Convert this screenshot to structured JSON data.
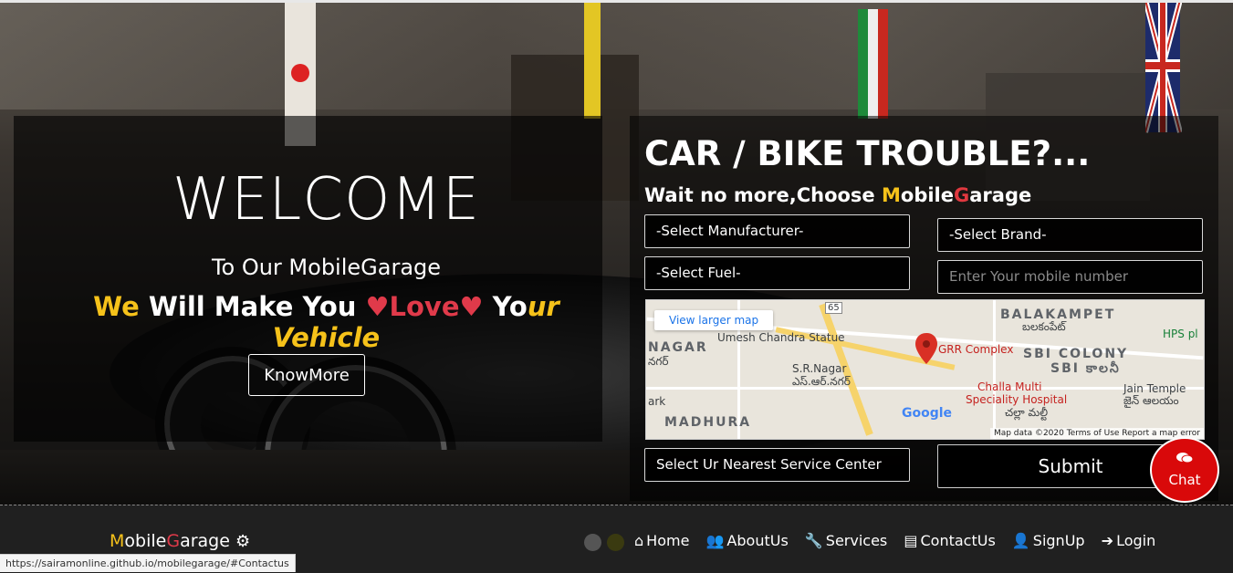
{
  "welcome": {
    "title": "WELCOME",
    "subtitle": "To Our MobileGarage",
    "tag_we": "We",
    "tag_mid": " Will Make You ",
    "tag_heart1": "♥",
    "tag_love": "Love",
    "tag_heart2": "♥",
    "tag_yo": " Yo",
    "tag_ur": "ur Vehicle",
    "button": "KnowMore"
  },
  "form": {
    "heading": "CAR / BIKE TROUBLE?...",
    "wait_prefix": "Wait no more,Choose ",
    "brand_m": "M",
    "brand_obile": "obile",
    "brand_g": "G",
    "brand_arage": "arage",
    "manufacturer": "-Select Manufacturer-",
    "brand": "-Select Brand-",
    "fuel": "-Select Fuel-",
    "mobile_placeholder": "Enter Your mobile number",
    "service_center": "Select Ur Nearest Service Center",
    "submit": "Submit"
  },
  "map": {
    "larger": "View larger map",
    "labels": {
      "umesh": "Umesh Chandra Statue",
      "grr": "GRR Complex",
      "balakampet": "BALAKAMPET",
      "balakampet_te": "బలకంపేట్",
      "sbi": "SBI COLONY",
      "sbi_te": "SBI కాలనీ",
      "nagar": "NAGAR",
      "nagar_te": "నగర్",
      "srnagar": "S.R.Nagar",
      "srnagar_te": "ఎస్.ఆర్.నగర్",
      "challa": "Challa Multi",
      "speciality": "Speciality Hospital",
      "challa_te": "చల్లా మల్టీ",
      "jain": "Jain Temple",
      "jain_te": "జైన్ ఆలయం",
      "madhura": "MADHURA",
      "hps": "HPS pl",
      "ark": "ark",
      "road65": "65",
      "google": "Google"
    },
    "footer": "Map data ©2020    Terms of Use    Report a map error"
  },
  "chat": {
    "label": "Chat",
    "icon": "chat-bubbles-icon"
  },
  "footer": {
    "brand_m": "M",
    "brand_obile": "obile",
    "brand_g": "G",
    "brand_arage": "arage",
    "nav": [
      "Home",
      "AboutUs",
      "Services",
      "ContactUs",
      "SignUp",
      "Login"
    ]
  },
  "status_url": "https://sairamonline.github.io/mobilegarage/#Contactus",
  "colors": {
    "accent_yellow": "#f6c21a",
    "accent_red": "#e03a4a",
    "chat_red": "#d9090a"
  }
}
